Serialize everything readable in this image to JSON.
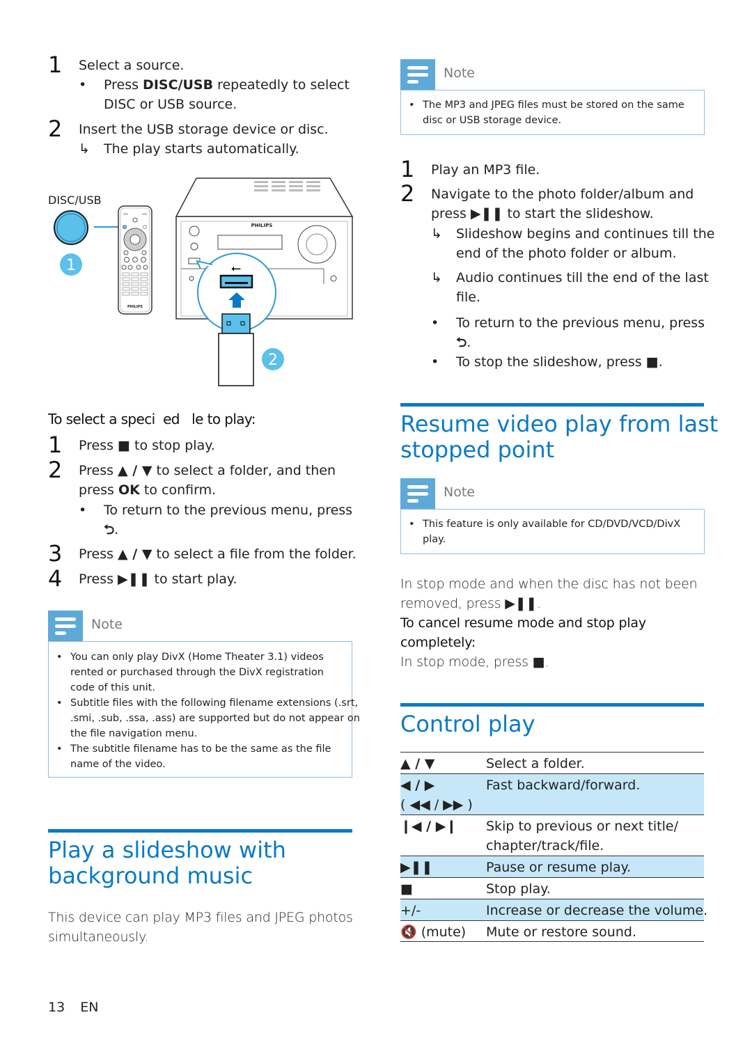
{
  "left_column": {
    "steps_top": [
      {
        "num": "1",
        "text": "Select a source.",
        "bullet": {
          "prefix": "Press ",
          "keyword": "DISC/USB",
          "suffix": " repeatedly to select",
          "line2": "DISC or USB source."
        }
      },
      {
        "num": "2",
        "text": "Insert the USB storage device or disc.",
        "result": "The play starts automatically."
      }
    ],
    "illustration": {
      "button_label": "DISC/USB",
      "callout_1": "1",
      "callout_2": "2",
      "brand": "PHILIPS",
      "accent_color": "#5bc0ea"
    },
    "select_file": {
      "heading": "To select a speci  ed   le to play:",
      "steps": [
        {
          "num": "1",
          "text_a": "Press ",
          "glyph": "■",
          "text_b": " to stop play."
        },
        {
          "num": "2",
          "text_a": "Press ",
          "glyph": "▲ / ▼",
          "text_b": " to select a folder, and then",
          "line2_a": "press ",
          "line2_kw": "OK",
          "line2_b": " to confirm."
        },
        {
          "num": "3",
          "text_a": "Press ",
          "glyph": "▲ / ▼",
          "text_b": " to select a file from the folder."
        },
        {
          "num": "4",
          "text_a": "Press ",
          "glyph": "▶❚❚",
          "text_b": " to start play."
        }
      ],
      "sub_bullet": {
        "text": "To return to the previous menu, press",
        "glyph": "⮌",
        "end": "."
      }
    },
    "note": {
      "label": "Note",
      "items": [
        [
          "You can only play DivX (Home Theater 3.1) videos",
          "rented or purchased through the DivX registration",
          "code of this unit."
        ],
        [
          "Subtitle files with the following filename extensions (.srt,",
          ".smi, .sub, .ssa, .ass) are supported but do not appear on",
          "the file navigation menu."
        ],
        [
          "The subtitle filename has to be the same as the file",
          "name of the video."
        ]
      ]
    },
    "slideshow_section": {
      "title_line1": "Play a slideshow with",
      "title_line2": "background music",
      "body_line1": "This device can play MP3 files and JPEG photos",
      "body_line2": "simultaneously."
    }
  },
  "right_column": {
    "note_top": {
      "label": "Note",
      "lines": [
        "The MP3 and JPEG files must be stored on the same",
        "disc or USB storage device."
      ]
    },
    "slideshow_steps": {
      "step1": {
        "num": "1",
        "text": "Play an MP3 file."
      },
      "step2": {
        "num": "2",
        "line1": "Navigate to the photo folder/album and",
        "line2_a": "press ",
        "glyph": "▶❚❚",
        "line2_b": " to start the slideshow."
      },
      "results": [
        [
          "Slideshow begins and continues till the",
          "end of the photo folder or album."
        ],
        [
          "Audio continues till the end of the last",
          "file."
        ]
      ],
      "bullets": [
        {
          "line1": "To return to the previous menu, press",
          "glyph": "⮌",
          "end": "."
        },
        {
          "text": "To stop the slideshow, press ",
          "glyph": "■",
          "end": "."
        }
      ]
    },
    "resume_section": {
      "title_line1": "Resume video play from last",
      "title_line2": "stopped point",
      "note": {
        "label": "Note",
        "lines": [
          "This feature is only available for CD/DVD/VCD/DivX",
          "play."
        ]
      },
      "para1_line1": "In stop mode and when the disc has not been",
      "para1_line2_a": "removed, press ",
      "para1_glyph": "▶❚❚",
      "para1_end": ".",
      "cancel_heading_line1": "To cancel resume mode and stop play",
      "cancel_heading_line2": "completely:",
      "para2_a": "In stop mode, press ",
      "para2_glyph": "■",
      "para2_end": "."
    },
    "control_section": {
      "title": "Control play",
      "rows": [
        {
          "key": "▲ / ▼",
          "desc": "Select a folder."
        },
        {
          "key": "◀ / ▶",
          "key2": "( ◀◀ / ▶▶ )",
          "desc": "Fast backward/forward."
        },
        {
          "key": "❙◀ / ▶❙",
          "desc": "Skip to previous or next title/",
          "desc2": "chapter/track/file."
        },
        {
          "key": "▶❚❚",
          "desc": "Pause or resume play."
        },
        {
          "key": "■",
          "desc": "Stop play."
        },
        {
          "key": "+/-",
          "desc": "Increase or decrease the volume."
        },
        {
          "key": "🔇 (mute)",
          "desc": "Mute or restore sound."
        }
      ]
    }
  },
  "footer": {
    "page": "13",
    "lang": "EN"
  }
}
